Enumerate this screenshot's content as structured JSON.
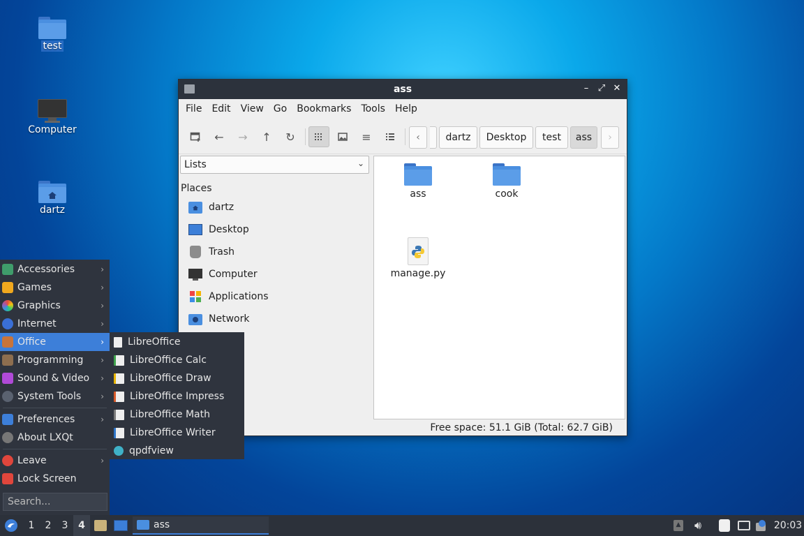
{
  "desktop": {
    "icons": [
      {
        "label": "test"
      },
      {
        "label": "Computer"
      },
      {
        "label": "dartz"
      }
    ]
  },
  "window": {
    "title": "ass",
    "controls": {
      "minimize": "–",
      "maximize": "⤢",
      "close": "✕"
    },
    "menu": [
      "File",
      "Edit",
      "View",
      "Go",
      "Bookmarks",
      "Tools",
      "Help"
    ],
    "breadcrumb": [
      "dartz",
      "Desktop",
      "test",
      "ass"
    ],
    "breadcrumb_prev": "‹",
    "breadcrumb_next": "›",
    "side_mode": "Lists",
    "places_header": "Places",
    "places": [
      "dartz",
      "Desktop",
      "Trash",
      "Computer",
      "Applications",
      "Network"
    ],
    "files": [
      {
        "name": "ass",
        "type": "folder"
      },
      {
        "name": "cook",
        "type": "folder"
      },
      {
        "name": "manage.py",
        "type": "python"
      }
    ],
    "status": "Free space: 51.1 GiB (Total: 62.7 GiB)"
  },
  "start_menu": {
    "items": [
      "Accessories",
      "Games",
      "Graphics",
      "Internet",
      "Office",
      "Programming",
      "Sound & Video",
      "System Tools",
      "Preferences",
      "About LXQt",
      "Leave",
      "Lock Screen"
    ],
    "highlighted": "Office",
    "search_placeholder": "Search...",
    "office_submenu": [
      "LibreOffice",
      "LibreOffice Calc",
      "LibreOffice Draw",
      "LibreOffice Impress",
      "LibreOffice Math",
      "LibreOffice Writer",
      "qpdfview"
    ]
  },
  "taskbar": {
    "desktops": [
      "1",
      "2",
      "3",
      "4"
    ],
    "current_desktop": "4",
    "task_label": "ass",
    "clock": "20:03"
  },
  "colors": {
    "accent": "#3d7fd9",
    "panel": "#2c313a",
    "menu_bg": "#2f343e",
    "folder": "#4a8fe0"
  }
}
